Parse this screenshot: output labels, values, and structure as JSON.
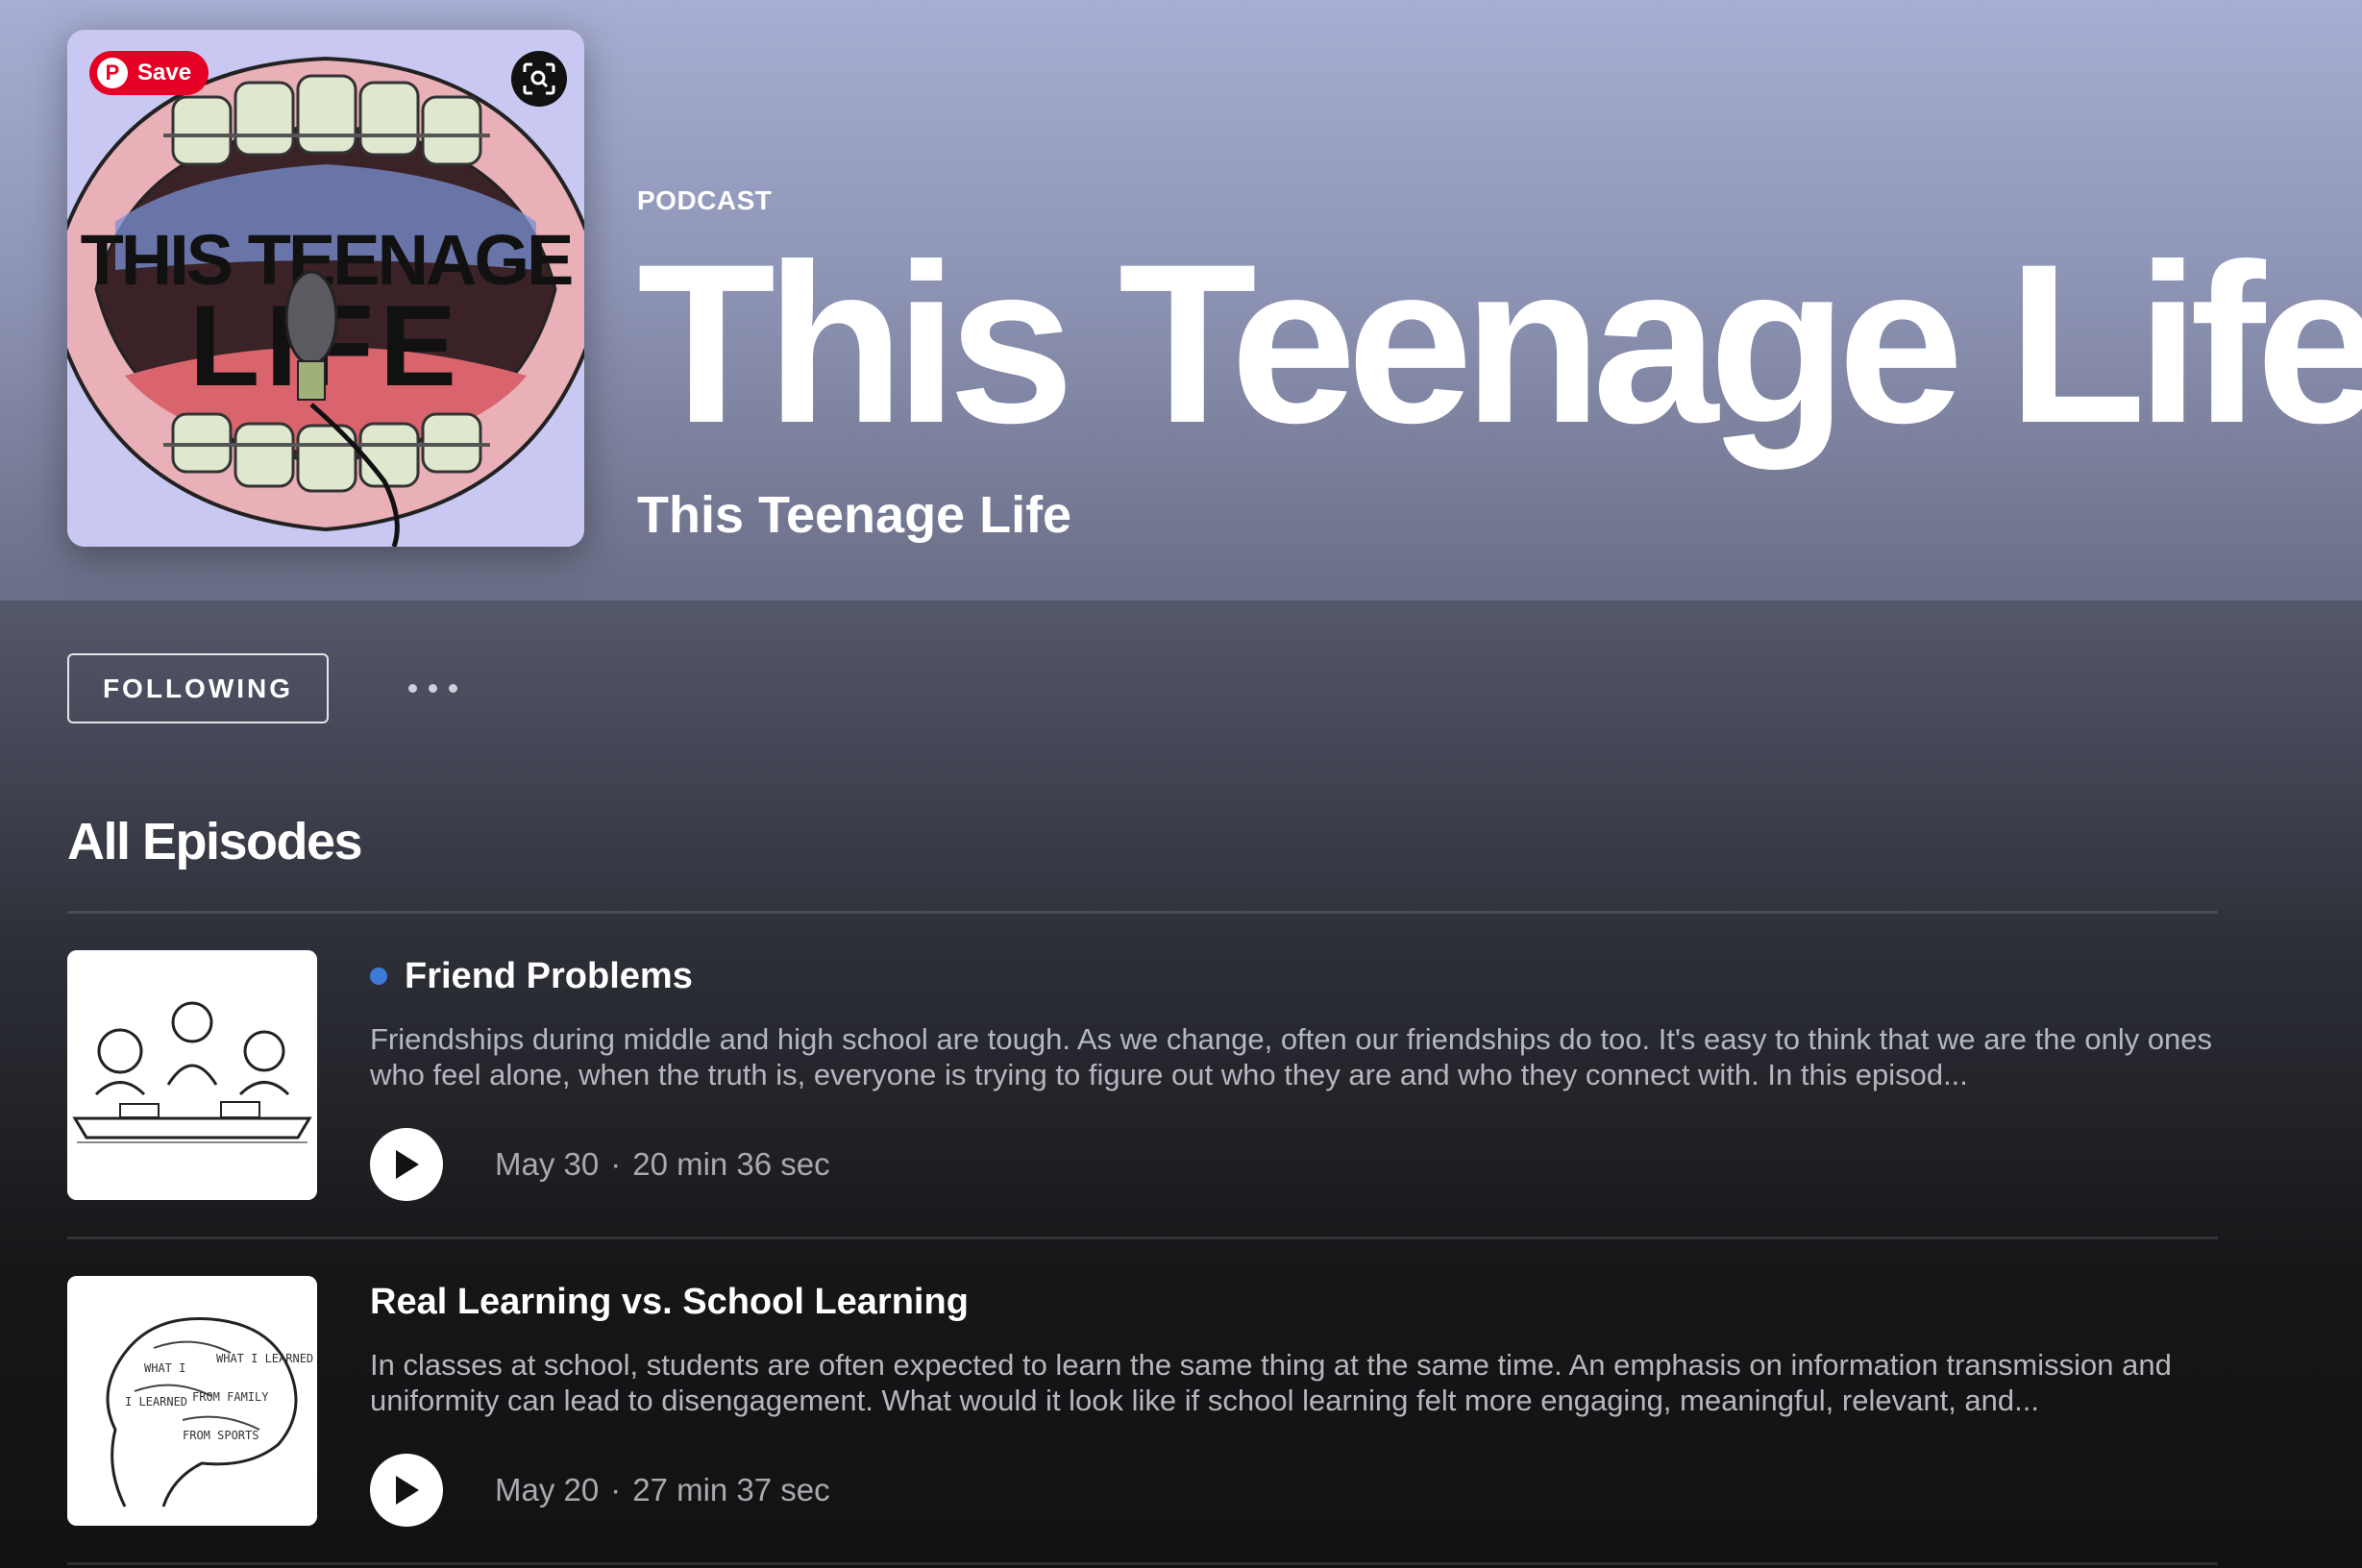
{
  "colors": {
    "hero_top": "#a7aed3",
    "background": "#121212",
    "new_dot": "#3d7bd9",
    "pinterest_red": "#e60023"
  },
  "cover": {
    "save_label": "Save",
    "art_text_line1": "THIS TEENAGE",
    "art_text_line2": "LIFE"
  },
  "header": {
    "type_label": "PODCAST",
    "title": "This Teenage Life",
    "publisher": "This Teenage Life"
  },
  "actions": {
    "follow_label": "FOLLOWING",
    "more_icon": "more-horizontal-icon"
  },
  "episodes_section": {
    "title": "All Episodes",
    "episodes": [
      {
        "title": "Friend Problems",
        "is_new": true,
        "description": "Friendships during middle and high school are tough. As we change, often our friendships do too. It's easy to think that we are the only ones who feel alone, when the truth is, everyone is trying to figure out who they are and who they connect with. In this episod...",
        "date": "May 30",
        "separator": "·",
        "duration": "20 min 36 sec"
      },
      {
        "title": "Real Learning vs. School Learning",
        "is_new": false,
        "description": "In classes at school, students are often expected to learn the same thing at the same time. An emphasis on information transmission and uniformity can lead to disengagement. What would it look like if school learning felt more engaging, meaningful, relevant, and...",
        "date": "May 20",
        "separator": "·",
        "duration": "27 min 37 sec"
      }
    ]
  }
}
